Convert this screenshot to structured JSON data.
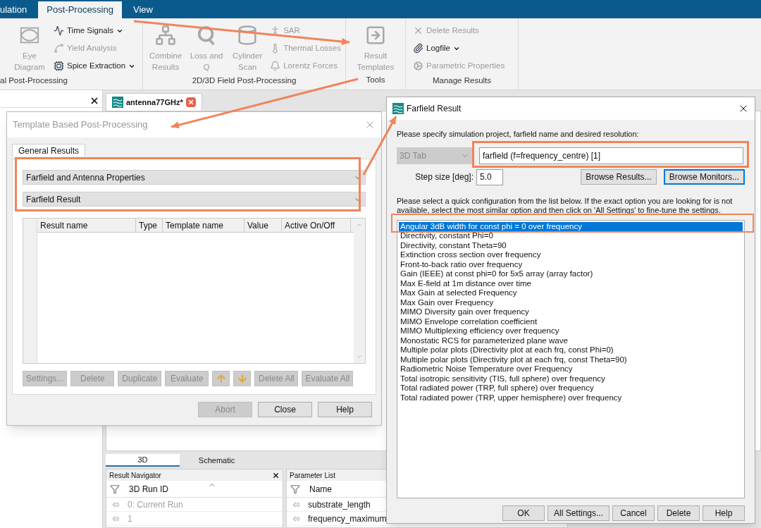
{
  "ribbon": {
    "tabs": [
      {
        "label": "ulation",
        "selected": false
      },
      {
        "label": "Post-Processing",
        "selected": true
      },
      {
        "label": "View",
        "selected": false
      }
    ],
    "groups": [
      {
        "title": "al Post-Processing",
        "items": [
          {
            "label": "Eye Diagram",
            "kind": "large",
            "disabled": true
          },
          {
            "label": "Time Signals",
            "kind": "small",
            "disabled": false,
            "dropdown": true
          },
          {
            "label": "Yield Analysis",
            "kind": "small",
            "disabled": true,
            "dropdown": false
          },
          {
            "label": "Spice Extraction",
            "kind": "small",
            "disabled": false,
            "dropdown": true
          }
        ]
      },
      {
        "title": "2D/3D Field Post-Processing",
        "items": [
          {
            "label": "Combine Results",
            "kind": "large",
            "disabled": true
          },
          {
            "label": "Loss and Q",
            "kind": "large",
            "disabled": true
          },
          {
            "label": "Cylinder Scan",
            "kind": "large",
            "disabled": true
          },
          {
            "label": "SAR",
            "kind": "small",
            "disabled": true,
            "dropdown": false
          },
          {
            "label": "Thermal Losses",
            "kind": "small",
            "disabled": true,
            "dropdown": false
          },
          {
            "label": "Lorentz Forces",
            "kind": "small",
            "disabled": true,
            "dropdown": false
          }
        ]
      },
      {
        "title": "Tools",
        "items": [
          {
            "label": "Result Templates",
            "kind": "large",
            "disabled": true
          }
        ]
      },
      {
        "title": "Manage Results",
        "items": [
          {
            "label": "Delete Results",
            "kind": "small",
            "disabled": true,
            "dropdown": false
          },
          {
            "label": "Logfile",
            "kind": "small",
            "disabled": false,
            "dropdown": true
          },
          {
            "label": "Parametric Properties",
            "kind": "small",
            "disabled": true,
            "dropdown": false
          }
        ]
      }
    ]
  },
  "document_tab": {
    "label": "antenna77GHz*"
  },
  "template_dialog": {
    "title": "Template Based Post-Processing",
    "tab": "General Results",
    "dropdowns": [
      "Farfield and Antenna Properties",
      "Farfield Result"
    ],
    "table": {
      "columns": [
        "Result name",
        "Type",
        "Template name",
        "Value",
        "Active On/Off"
      ]
    },
    "buttons": [
      {
        "label": "Settings...",
        "kind": "text",
        "disabled": true
      },
      {
        "label": "Delete",
        "kind": "text",
        "disabled": true
      },
      {
        "label": "Duplicate",
        "kind": "text",
        "disabled": true
      },
      {
        "label": "Evaluate",
        "kind": "text",
        "disabled": true
      },
      {
        "kind": "up",
        "disabled": true
      },
      {
        "kind": "down",
        "disabled": true
      },
      {
        "label": "Delete All",
        "kind": "text",
        "disabled": true
      },
      {
        "label": "Evaluate All",
        "kind": "text",
        "disabled": true
      }
    ],
    "footer_buttons": [
      {
        "label": "Abort",
        "disabled": true
      },
      {
        "label": "Close",
        "disabled": false
      },
      {
        "label": "Help",
        "disabled": false
      }
    ]
  },
  "farfield_dialog": {
    "title": "Farfield Result",
    "prompt": "Please specify simulation project, farfield name and desired resolution:",
    "project_combo": {
      "value": "3D Tab",
      "disabled": true
    },
    "farfield_field": {
      "value": "farfield (f=frequency_centre) [1]"
    },
    "step_label": "Step size [deg]:",
    "step_field": {
      "value": "5.0"
    },
    "browse_buttons": [
      {
        "label": "Browse Results...",
        "focused": false
      },
      {
        "label": "Browse Monitors...",
        "focused": true
      }
    ],
    "instructions": "Please select a quick configuration from the list below. If the exact option you are looking for is not available, select the most similar option and then click on 'All Settings' to fine-tune the settings.",
    "options": [
      {
        "label": "Angular 3dB width for const phi = 0 over frequency",
        "selected": true
      },
      {
        "label": "Directivity, constant Phi=0",
        "selected": false
      },
      {
        "label": "Directivity, constant Theta=90",
        "selected": false
      },
      {
        "label": "Extinction cross section over frequency",
        "selected": false
      },
      {
        "label": "Front-to-back ratio over frequency",
        "selected": false
      },
      {
        "label": "Gain (IEEE) at const phi=0 for 5x5 array (array factor)",
        "selected": false
      },
      {
        "label": "Max E-field at 1m distance over time",
        "selected": false
      },
      {
        "label": "Max Gain at selected Frequency",
        "selected": false
      },
      {
        "label": "Max Gain over Frequency",
        "selected": false
      },
      {
        "label": "MIMO Diversity gain over frequency",
        "selected": false
      },
      {
        "label": "MIMO Envelope correlation coefficient",
        "selected": false
      },
      {
        "label": "MIMO Multiplexing efficiency over frequency",
        "selected": false
      },
      {
        "label": "Monostatic RCS for parameterized plane wave",
        "selected": false
      },
      {
        "label": "Multiple polar plots (Directivity plot at each frq, const Phi=0)",
        "selected": false
      },
      {
        "label": "Multiple polar plots (Directivity plot at each frq, const Theta=90)",
        "selected": false
      },
      {
        "label": "Radiometric Noise Temperature over Frequency",
        "selected": false
      },
      {
        "label": "Total isotropic sensitivity (TIS, full sphere) over frequency",
        "selected": false
      },
      {
        "label": "Total radiated power (TRP, full sphere) over frequency",
        "selected": false
      },
      {
        "label": "Total radiated power (TRP, upper hemisphere) over frequency",
        "selected": false
      }
    ],
    "buttons": [
      "OK",
      "All Settings...",
      "Cancel",
      "Delete",
      "Help"
    ]
  },
  "view_tabs": [
    {
      "label": "3D",
      "selected": true
    },
    {
      "label": "Schematic",
      "selected": false
    }
  ],
  "result_navigator": {
    "title": "Result Navigator",
    "column": "3D Run ID",
    "rows": [
      {
        "text": "0: Current Run",
        "disabled": true
      },
      {
        "text": "1",
        "disabled": true
      }
    ]
  },
  "parameter_list": {
    "title": "Parameter List",
    "column": "Name",
    "rows": [
      {
        "text": "substrate_length",
        "disabled": false
      },
      {
        "text": "frequency_maximum",
        "disabled": false
      }
    ]
  }
}
